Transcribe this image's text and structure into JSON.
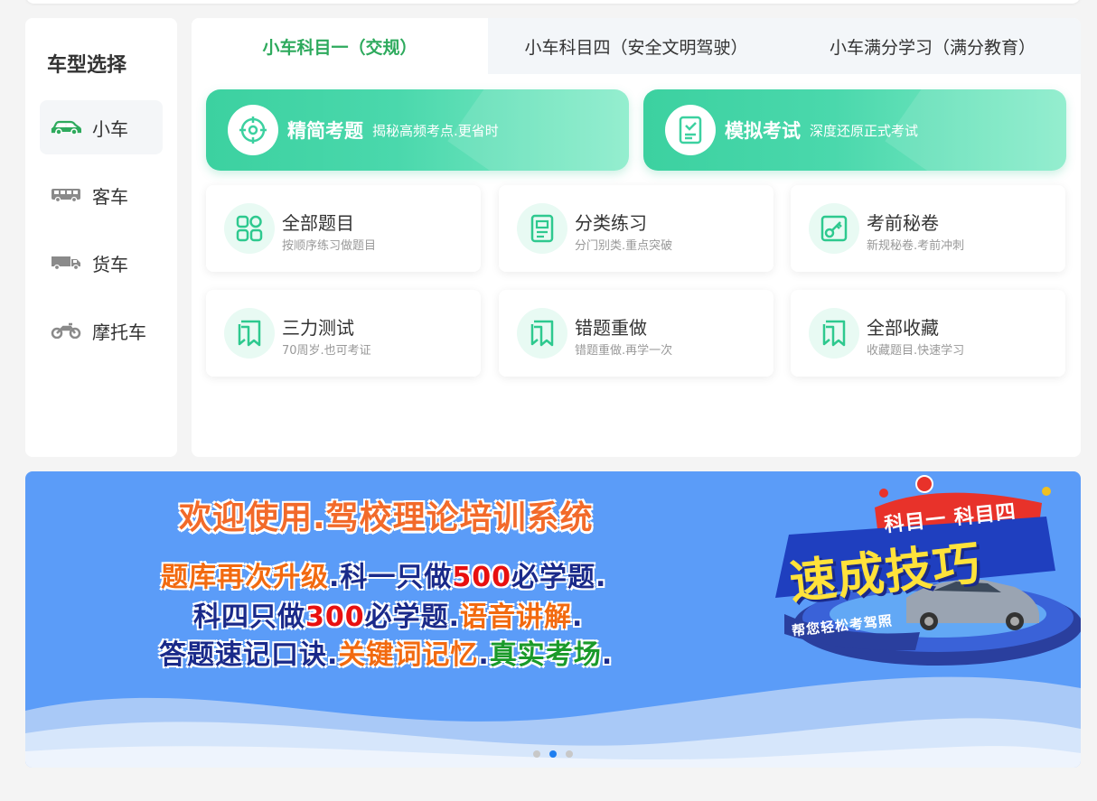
{
  "sidebar": {
    "title": "车型选择",
    "items": [
      {
        "label": "小车",
        "icon": "car-icon",
        "active": true
      },
      {
        "label": "客车",
        "icon": "bus-icon",
        "active": false
      },
      {
        "label": "货车",
        "icon": "truck-icon",
        "active": false
      },
      {
        "label": "摩托车",
        "icon": "motorcycle-icon",
        "active": false
      }
    ]
  },
  "tabs": [
    {
      "label": "小车科目一（交规）",
      "active": true
    },
    {
      "label": "小车科目四（安全文明驾驶）",
      "active": false
    },
    {
      "label": "小车满分学习（满分教育）",
      "active": false
    }
  ],
  "heroes": [
    {
      "title": "精简考题",
      "subtitle": "揭秘高频考点.更省时",
      "icon": "target-icon"
    },
    {
      "title": "模拟考试",
      "subtitle": "深度还原正式考试",
      "icon": "checklist-icon"
    }
  ],
  "cards": [
    {
      "title": "全部题目",
      "subtitle": "按顺序练习做题目",
      "icon": "grid-icon"
    },
    {
      "title": "分类练习",
      "subtitle": "分门别类.重点突破",
      "icon": "document-icon"
    },
    {
      "title": "考前秘卷",
      "subtitle": "新规秘卷.考前冲刺",
      "icon": "key-icon"
    },
    {
      "title": "三力测试",
      "subtitle": "70周岁.也可考证",
      "icon": "bookmark-icon"
    },
    {
      "title": "错题重做",
      "subtitle": "错题重做.再学一次",
      "icon": "bookmark-icon"
    },
    {
      "title": "全部收藏",
      "subtitle": "收藏题目.快速学习",
      "icon": "bookmark-icon"
    }
  ],
  "banner": {
    "title": "欢迎使用.驾校理论培训系统",
    "line1": {
      "a": "题库再次升级",
      "b": ".科一只做",
      "c": "500",
      "d": "必学题."
    },
    "line2": {
      "a": "科四只做",
      "b": "300",
      "c": "必学题.",
      "d": "语音讲解",
      "e": "."
    },
    "line3": {
      "a": "答题速记口诀.",
      "b": "关键词记忆",
      "c": ".",
      "d": "真实考场",
      "e": "."
    },
    "badge_top": "科目一 科目四",
    "badge_main": "速成技巧",
    "badge_ribbon": "帮您轻松考驾照"
  },
  "carousel": {
    "count": 3,
    "active": 1
  },
  "colors": {
    "accent": "#2eaa5d",
    "hero": "#3cd1a0",
    "icon": "#2ec98f",
    "banner": "#5b9cf8",
    "dot_active": "#1e7ef0"
  }
}
